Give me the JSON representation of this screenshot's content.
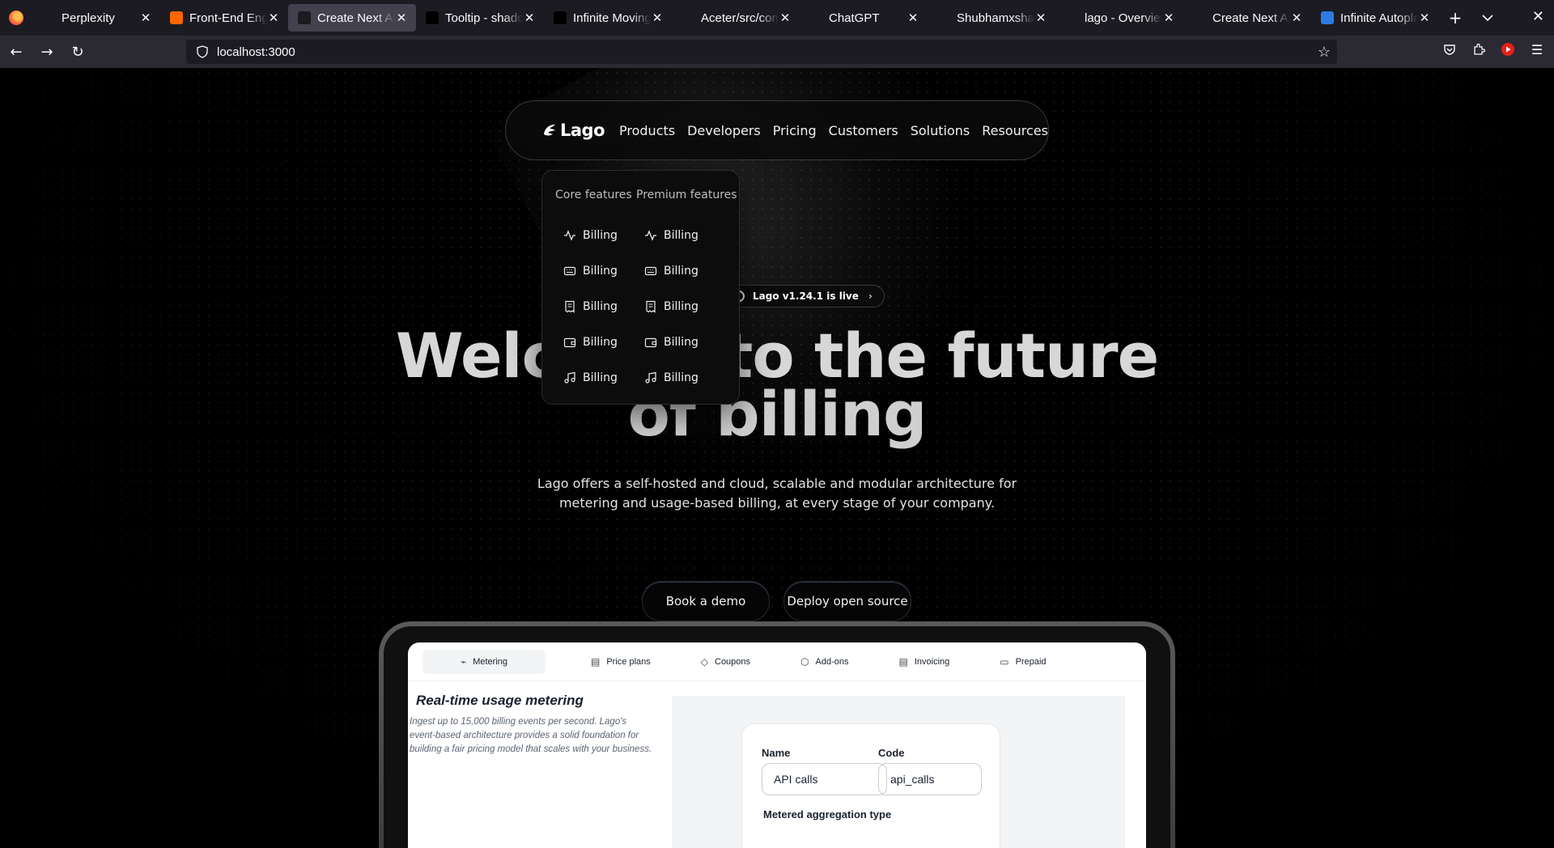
{
  "browser": {
    "tabs": [
      {
        "title": "Perplexity",
        "favicon": "perplexity-icon",
        "fav_bg": "#1c1b22",
        "fav_color": "#fff"
      },
      {
        "title": "Front-End Eng",
        "favicon": "ycombinator-icon",
        "fav_bg": "#ff6600",
        "fav_color": "#fff"
      },
      {
        "title": "Create Next Ap",
        "favicon": "vercel-icon",
        "fav_bg": "#1c1b22",
        "fav_color": "#fff",
        "active": true
      },
      {
        "title": "Tooltip - shadc",
        "favicon": "shadcn-icon",
        "fav_bg": "#000",
        "fav_color": "#fff"
      },
      {
        "title": "Infinite Moving",
        "favicon": "aceternity-icon",
        "fav_bg": "#000",
        "fav_color": "#fff"
      },
      {
        "title": "Aceter/src/com",
        "favicon": "github-icon",
        "fav_bg": "#1c1b22",
        "fav_color": "#fff"
      },
      {
        "title": "ChatGPT",
        "favicon": "openai-icon",
        "fav_bg": "#1c1b22",
        "fav_color": "#fff"
      },
      {
        "title": "Shubhamxshah",
        "favicon": "github-icon",
        "fav_bg": "#1c1b22",
        "fav_color": "#fff"
      },
      {
        "title": "lago - Overview",
        "favicon": "vercel-icon",
        "fav_bg": "#1c1b22",
        "fav_color": "#fff"
      },
      {
        "title": "Create Next Ap",
        "favicon": "vercel-icon",
        "fav_bg": "#1c1b22",
        "fav_color": "#fff"
      },
      {
        "title": "Infinite Autopla",
        "favicon": "ac-icon",
        "fav_bg": "#2c7be5",
        "fav_color": "#fff"
      }
    ],
    "url": "localhost:3000"
  },
  "site": {
    "brand": "Lago",
    "nav": [
      "Products",
      "Developers",
      "Pricing",
      "Customers",
      "Solutions",
      "Resources"
    ],
    "dropdown": {
      "core_heading": "Core features",
      "premium_heading": "Premium features",
      "core_items": [
        {
          "label": "Billing",
          "icon": "activity-icon"
        },
        {
          "label": "Billing",
          "icon": "keyboard-icon"
        },
        {
          "label": "Billing",
          "icon": "receipt-icon"
        },
        {
          "label": "Billing",
          "icon": "wallet-icon"
        },
        {
          "label": "Billing",
          "icon": "music-icon"
        }
      ],
      "premium_items": [
        {
          "label": "Billing",
          "icon": "activity-icon"
        },
        {
          "label": "Billing",
          "icon": "keyboard-icon"
        },
        {
          "label": "Billing",
          "icon": "receipt-icon"
        },
        {
          "label": "Billing",
          "icon": "wallet-icon"
        },
        {
          "label": "Billing",
          "icon": "music-icon"
        }
      ]
    },
    "badge": "Lago v1.24.1 is live",
    "hero_line1": "Welcome to the future",
    "hero_line2": "of billing",
    "subtitle": "Lago offers a self-hosted and cloud, scalable and modular architecture for metering and usage-based billing, at every stage of your company.",
    "cta_primary": "Book a demo",
    "cta_secondary": "Deploy open source"
  },
  "preview": {
    "tabs": [
      {
        "label": "Metering",
        "icon": "metering-icon"
      },
      {
        "label": "Price plans",
        "icon": "price-plan-icon"
      },
      {
        "label": "Coupons",
        "icon": "coupon-icon"
      },
      {
        "label": "Add-ons",
        "icon": "addon-icon"
      },
      {
        "label": "Invoicing",
        "icon": "invoice-icon"
      },
      {
        "label": "Prepaid",
        "icon": "wallet-icon"
      }
    ],
    "feature_title": "Real-time usage metering",
    "feature_desc": "Ingest up to 15,000 billing events per second. Lago's event-based architecture provides a solid foundation for building a fair pricing model that scales with your business.",
    "form": {
      "name_label": "Name",
      "name_value": "API calls",
      "code_label": "Code",
      "code_value": "api_calls",
      "aggregation_label": "Metered aggregation type"
    }
  },
  "colors": {
    "tabbar_bg": "#1c1b22",
    "toolbar_bg": "#2b2a33",
    "active_tab": "#42414d",
    "page_bg": "#000000"
  }
}
